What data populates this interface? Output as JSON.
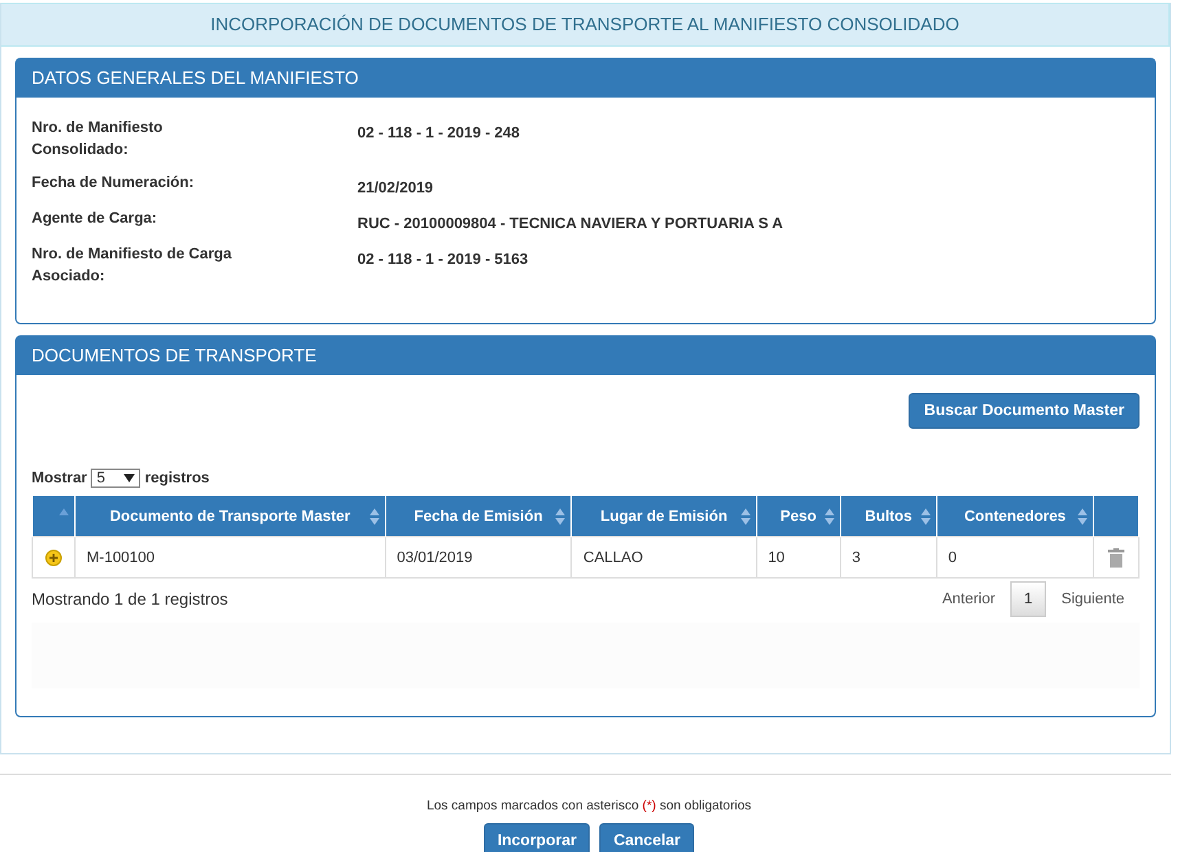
{
  "page_title": "INCORPORACIÓN DE DOCUMENTOS DE TRANSPORTE AL MANIFIESTO CONSOLIDADO",
  "general_panel": {
    "title": "DATOS GENERALES DEL MANIFIESTO",
    "fields": [
      {
        "label": "Nro. de Manifiesto Consolidado:",
        "value": "02 - 118 - 1 - 2019 - 248"
      },
      {
        "label": "Fecha de Numeración:",
        "value": "21/02/2019"
      },
      {
        "label": "Agente de Carga:",
        "value": "RUC - 20100009804 - TECNICA NAVIERA Y PORTUARIA S A"
      },
      {
        "label": "Nro. de Manifiesto de Carga Asociado:",
        "value": "02 - 118 - 1 - 2019 - 5163"
      }
    ]
  },
  "documents_panel": {
    "title": "DOCUMENTOS DE TRANSPORTE",
    "search_button": "Buscar Documento Master",
    "page_size": {
      "before": "Mostrar",
      "value": "5",
      "after": "registros"
    },
    "table": {
      "columns": [
        "Documento de Transporte Master",
        "Fecha de Emisión",
        "Lugar de Emisión",
        "Peso",
        "Bultos",
        "Contenedores"
      ],
      "rows": [
        {
          "cells": [
            "M-100100",
            "03/01/2019",
            "CALLAO",
            "10",
            "3",
            "0"
          ]
        }
      ]
    },
    "info": "Mostrando 1 de 1 registros",
    "pagination": {
      "previous": "Anterior",
      "pages": [
        {
          "label": "1",
          "selected": true
        }
      ],
      "next": "Siguiente"
    }
  },
  "required_note": {
    "before": "Los campos marcados con asterisco",
    "mark": "(*)",
    "after": "son obligatorios"
  },
  "buttons": [
    "Incorporar",
    "Cancelar"
  ]
}
